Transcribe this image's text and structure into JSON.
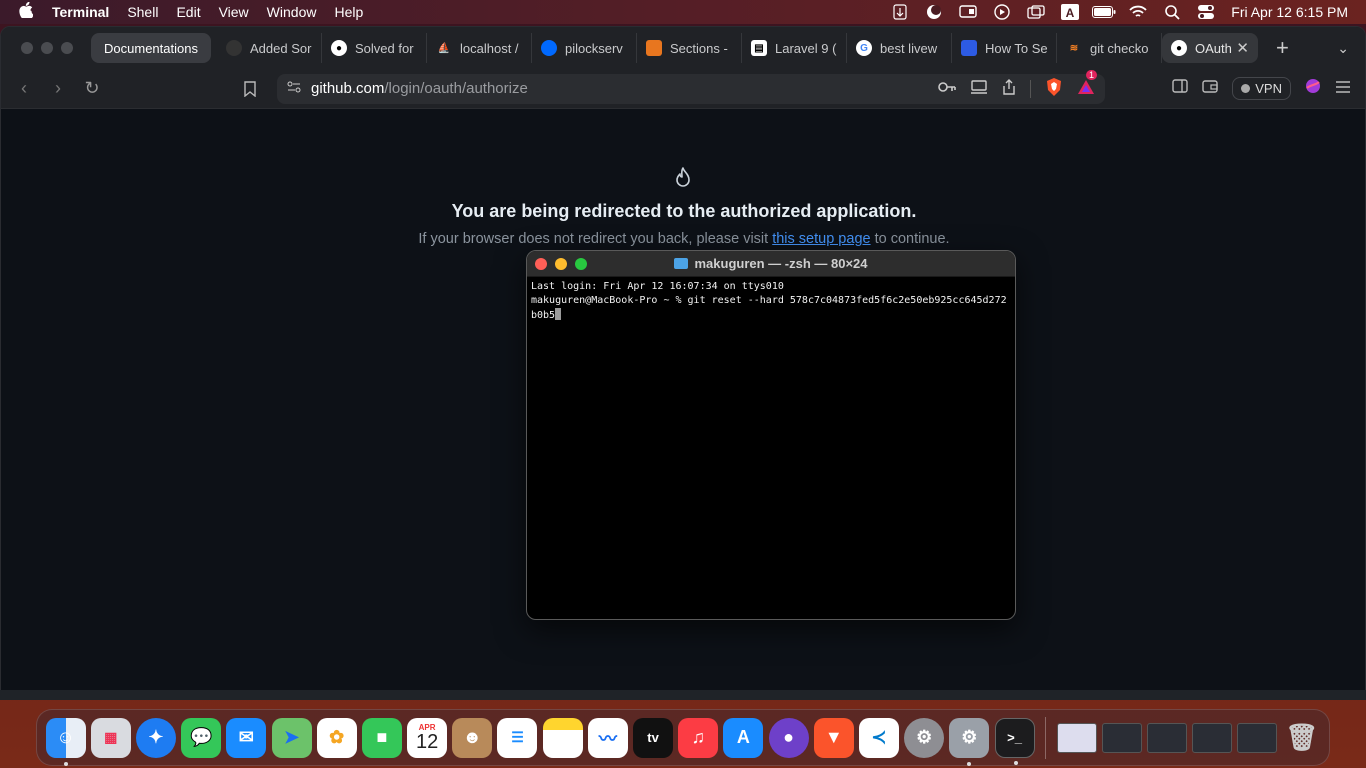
{
  "menubar": {
    "app": "Terminal",
    "items": [
      "Shell",
      "Edit",
      "View",
      "Window",
      "Help"
    ],
    "clock": "Fri Apr 12  6:15 PM"
  },
  "tabs": [
    {
      "label": "Documentations",
      "favicon": "none"
    },
    {
      "label": "Added Sor",
      "favicon": "github-icon"
    },
    {
      "label": "Solved for",
      "favicon": "github-icon"
    },
    {
      "label": "localhost /",
      "favicon": "phpmyadmin-icon"
    },
    {
      "label": "pilockserv",
      "favicon": "digitalocean-icon"
    },
    {
      "label": "Sections -",
      "favicon": "shopify-icon"
    },
    {
      "label": "Laravel 9 (",
      "favicon": "laravel-icon"
    },
    {
      "label": "best livew",
      "favicon": "google-icon"
    },
    {
      "label": "How To Se",
      "favicon": "site-icon"
    },
    {
      "label": "git checko",
      "favicon": "stackoverflow-icon"
    },
    {
      "label": "OAuth",
      "favicon": "github-icon"
    }
  ],
  "address": {
    "domain": "github.com",
    "path": "/login/oauth/authorize"
  },
  "toolbar": {
    "vpn_label": "VPN",
    "brave_rewards_badge": "1"
  },
  "page": {
    "heading": "You are being redirected to the authorized application.",
    "sub_before": "If your browser does not redirect you back, please visit ",
    "sub_link": "this setup page",
    "sub_after": " to continue."
  },
  "terminal": {
    "title": "makuguren — -zsh — 80×24",
    "line1": "Last login: Fri Apr 12 16:07:34 on ttys010",
    "line2": "makuguren@MacBook-Pro ~ % git reset --hard 578c7c04873fed5f6c2e50eb925cc645d272b0b5"
  },
  "dock": {
    "calendar_month": "APR",
    "calendar_day": "12",
    "apps": [
      "finder-icon",
      "launchpad-icon",
      "safari-icon",
      "messages-icon",
      "mail-icon",
      "maps-icon",
      "photos-icon",
      "facetime-icon",
      "calendar-icon",
      "contacts-icon",
      "reminders-icon",
      "notes-icon",
      "freeform-icon",
      "appletv-icon",
      "music-icon",
      "appstore-icon",
      "github-desktop-icon",
      "brave-icon",
      "vscode-icon",
      "system-settings-icon",
      "system-preferences-icon",
      "terminal-icon"
    ]
  }
}
